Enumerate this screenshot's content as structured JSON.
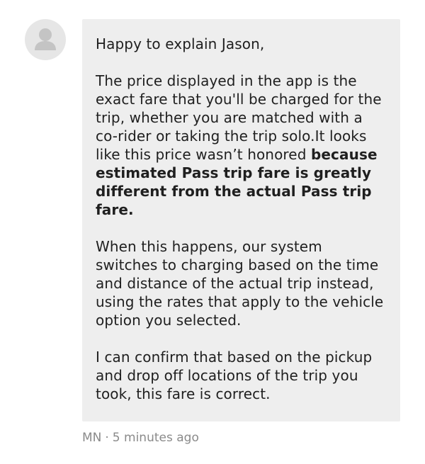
{
  "message": {
    "greeting": "Happy to explain Jason,",
    "paragraph1_plain": "The price displayed in the app is the exact fare that you'll be charged for the trip, whether you are matched with a co-rider or taking the trip solo.It looks like this price wasn’t honored ",
    "paragraph1_bold": "because estimated Pass trip fare is greatly different from the actual Pass trip fare.",
    "paragraph2": "When this happens, our system switches to charging based on the time and distance of the actual trip instead, using the rates that apply to the vehicle option you selected.",
    "paragraph3": "I can confirm that based on the pickup and drop off locations of the trip you took, this fare is correct."
  },
  "meta": {
    "author": "MN",
    "separator": "·",
    "time": "5 minutes ago"
  },
  "avatar": {
    "icon": "user-silhouette-icon",
    "colors": {
      "background": "#e6e6e6",
      "figure": "#c4c4c4"
    }
  },
  "colors": {
    "bubble": "#eeeeee",
    "text": "#1f1f1f",
    "meta_text": "#8a8a8a"
  }
}
